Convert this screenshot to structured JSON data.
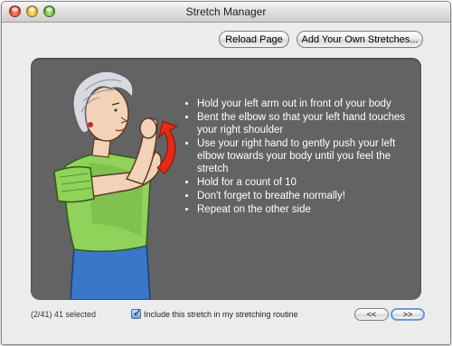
{
  "window": {
    "title": "Stretch Manager"
  },
  "toolbar": {
    "reload_label": "Reload Page",
    "add_label": "Add Your Own Stretches..."
  },
  "instructions": [
    "Hold your left arm out in front of your body",
    "Bent the elbow so that your left hand touches your right shoulder",
    "Use your right hand to gently push your left elbow towards your body until you feel the stretch",
    "Hold for a count of 10",
    "Don't forget to breathe normally!",
    "Repeat on the other side"
  ],
  "footer": {
    "status": "(2/41) 41 selected",
    "include_label": "Include this stretch in my stretching routine",
    "include_checked": true,
    "prev_label": "<<",
    "next_label": ">>"
  },
  "colors": {
    "panel": "#636363",
    "shirt": "#8fd35a",
    "arrow": "#e62a16",
    "skirt": "#3a77c8"
  }
}
